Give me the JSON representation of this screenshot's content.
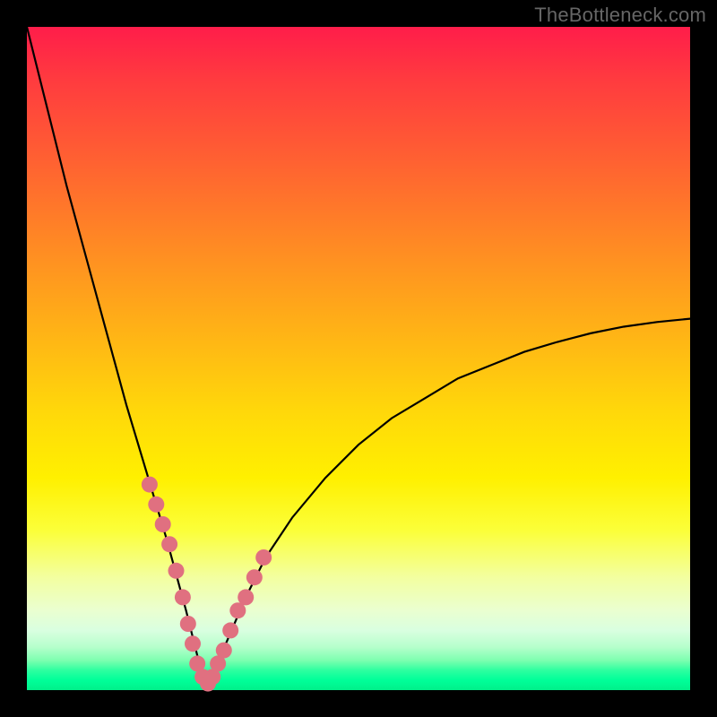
{
  "watermark": "TheBottleneck.com",
  "chart_data": {
    "type": "line",
    "title": "",
    "xlabel": "",
    "ylabel": "",
    "xlim": [
      0,
      100
    ],
    "ylim": [
      0,
      100
    ],
    "grid": false,
    "legend": false,
    "background": "rainbow-vertical-gradient",
    "description": "V-shaped bottleneck curve with minimum near x≈27; curve values approach 100 at x=0 and ~56 at x=100",
    "series": [
      {
        "name": "bottleneck-curve",
        "x": [
          0,
          3,
          6,
          9,
          12,
          15,
          18,
          21,
          24,
          26,
          27,
          28,
          30,
          33,
          36,
          40,
          45,
          50,
          55,
          60,
          65,
          70,
          75,
          80,
          85,
          90,
          95,
          100
        ],
        "y": [
          100,
          88,
          76,
          65,
          54,
          43,
          33,
          23,
          12,
          4,
          1,
          2,
          7,
          14,
          20,
          26,
          32,
          37,
          41,
          44,
          47,
          49,
          51,
          52.5,
          53.8,
          54.8,
          55.5,
          56
        ]
      }
    ],
    "markers": {
      "name": "highlighted-points",
      "color": "#e07080",
      "radius_px": 9,
      "x": [
        18.5,
        19.5,
        20.5,
        21.5,
        22.5,
        23.5,
        24.3,
        25.0,
        25.7,
        26.5,
        27.3,
        28.0,
        28.8,
        29.7,
        30.7,
        31.8,
        33.0,
        34.3,
        35.7
      ],
      "y": [
        31,
        28,
        25,
        22,
        18,
        14,
        10,
        7,
        4,
        2,
        1,
        2,
        4,
        6,
        9,
        12,
        14,
        17,
        20
      ]
    }
  }
}
